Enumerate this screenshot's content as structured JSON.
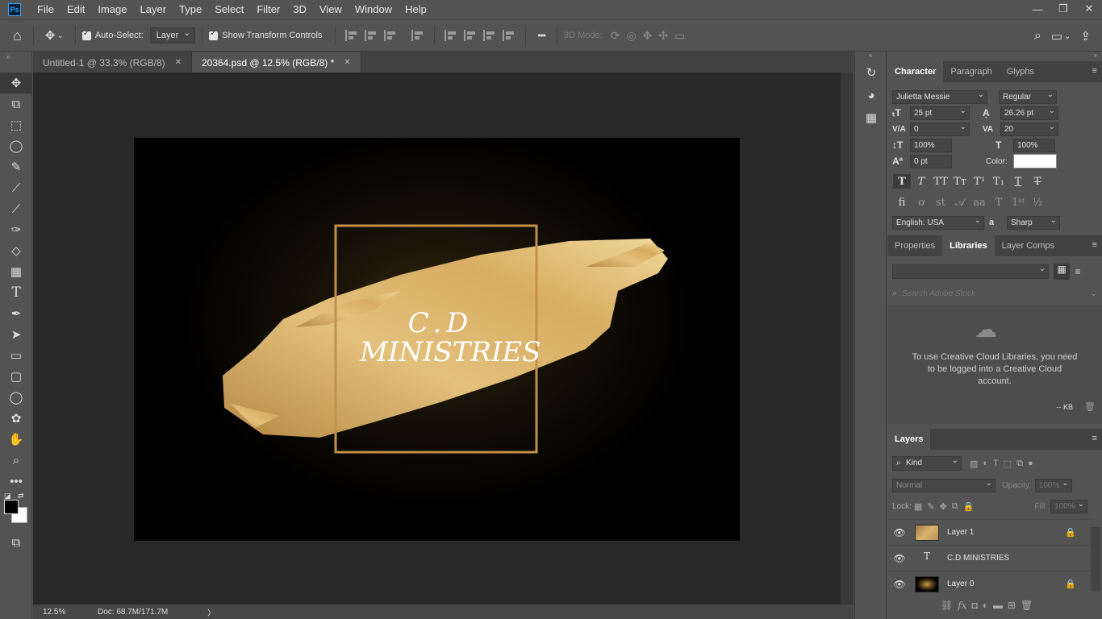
{
  "app": {
    "logo": "Ps"
  },
  "menu": [
    "File",
    "Edit",
    "Image",
    "Layer",
    "Type",
    "Select",
    "Filter",
    "3D",
    "View",
    "Window",
    "Help"
  ],
  "window_controls": {
    "minimize": "—",
    "restore": "❐",
    "close": "✕"
  },
  "options": {
    "auto_select_label": "Auto-Select:",
    "auto_select_value": "Layer",
    "transform_label": "Show Transform Controls",
    "more": "•••",
    "mode_3d_label": "3D Mode:"
  },
  "tabs": [
    {
      "label": "Untitled-1 @ 33.3% (RGB/8)",
      "close": "✕"
    },
    {
      "label": "20364.psd @ 12.5% (RGB/8) *",
      "close": "✕"
    }
  ],
  "artwork": {
    "line1": "C.D",
    "line2": "MINISTRIES"
  },
  "status": {
    "zoom": "12.5%",
    "doc": "Doc: 68.7M/171.7M",
    "arrow": "〉"
  },
  "character_panel": {
    "tabs": [
      "Character",
      "Paragraph",
      "Glyphs"
    ],
    "font_family": "Julietta Messie",
    "font_style": "Regular",
    "size": "25 pt",
    "leading": "26.26 pt",
    "kerning": "0",
    "tracking": "20",
    "vscale": "100%",
    "hscale": "100%",
    "baseline": "0 pt",
    "color_label": "Color:",
    "language": "English: USA",
    "aa_label": "a",
    "antialias": "Sharp"
  },
  "libraries_panel": {
    "tabs": [
      "Properties",
      "Libraries",
      "Layer Comps"
    ],
    "search_placeholder": "Search Adobe Stock",
    "message": "To use Creative Cloud Libraries, you need to be logged into a Creative Cloud account.",
    "kb": "-- KB"
  },
  "layers_panel": {
    "tab": "Layers",
    "kind": "Kind",
    "blend": "Normal",
    "opacity_label": "Opacity:",
    "opacity": "100%",
    "lock_label": "Lock:",
    "fill_label": "Fill:",
    "fill": "100%",
    "layers": [
      {
        "name": "Layer 1",
        "type": "image",
        "locked": true
      },
      {
        "name": "C.D MINISTRIES",
        "type": "text",
        "locked": false
      },
      {
        "name": "Layer 0",
        "type": "image",
        "locked": true
      }
    ]
  },
  "colors": {
    "accent": "#31a8ff",
    "gold": "#c89a4a",
    "panel": "#535353",
    "dark": "#424242",
    "canvas": "#282828"
  }
}
